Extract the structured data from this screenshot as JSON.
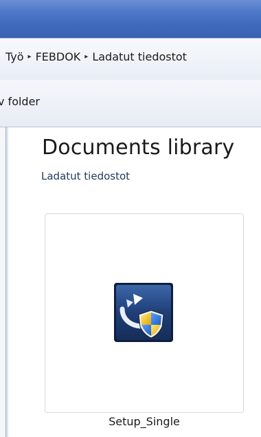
{
  "breadcrumb": {
    "items": [
      "Työ",
      "FEBDOK",
      "Ladatut tiedostot"
    ],
    "separator": "▸"
  },
  "toolbar": {
    "new_folder_label": "v folder"
  },
  "library": {
    "title": "Documents library",
    "subtitle": "Ladatut tiedostot"
  },
  "file": {
    "name": "Setup_Single",
    "icon": "installer-shield-icon"
  },
  "colors": {
    "titlebar": "#3f6bbd",
    "subtitle_text": "#1e395b",
    "icon_bg": "#1f3f78"
  }
}
